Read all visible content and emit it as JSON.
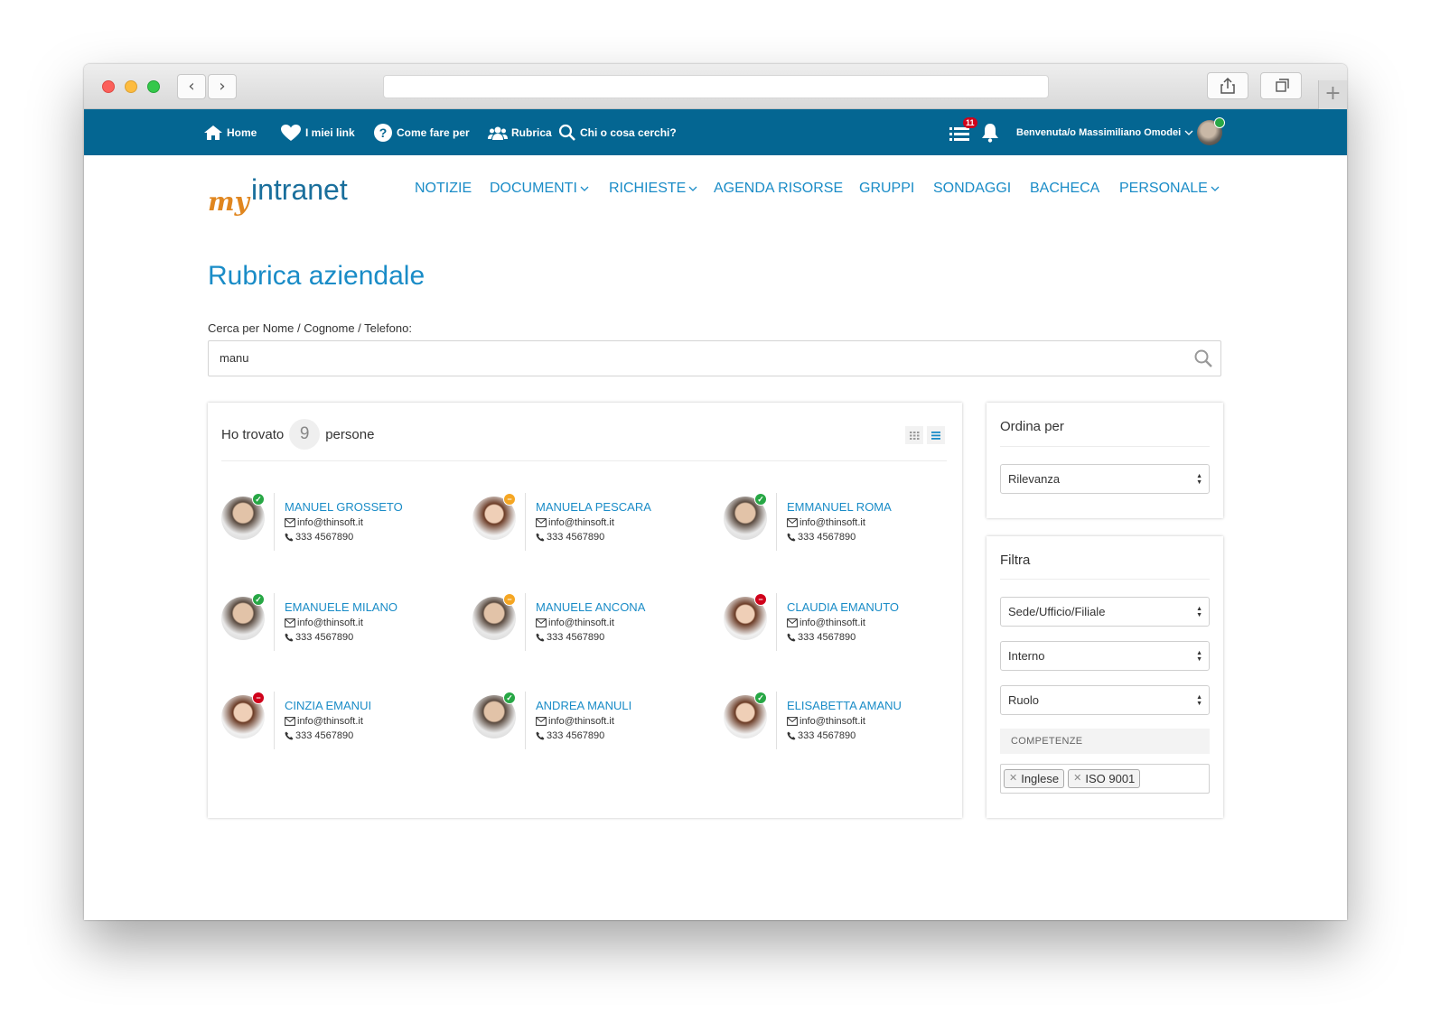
{
  "topbar": {
    "home": "Home",
    "links": "I miei link",
    "howto": "Come fare per",
    "rubrica": "Rubrica",
    "search": "Chi o cosa cerchi?",
    "tasks_count": "11",
    "welcome": "Benvenuta/o Massimiliano Omodei"
  },
  "brand": {
    "my": "my",
    "name": "intranet",
    "accent": "#e0861f",
    "primary": "#1a8cc7",
    "bar": "#046692"
  },
  "nav": {
    "items": [
      "NOTIZIE",
      "DOCUMENTI",
      "RICHIESTE",
      "AGENDA RISORSE",
      "GRUPPI",
      "SONDAGGI",
      "BACHECA",
      "PERSONALE"
    ]
  },
  "page": {
    "title": "Rubrica aziendale",
    "search_label": "Cerca per Nome / Cognome / Telefono:",
    "search_value": "manu"
  },
  "results": {
    "prefix": "Ho trovato",
    "count": "9",
    "suffix": "persone",
    "people": [
      {
        "name": "MANUEL GROSSETO",
        "email": "info@thinsoft.it",
        "phone": "333 4567890",
        "status": "online"
      },
      {
        "name": "MANUELA PESCARA",
        "email": "info@thinsoft.it",
        "phone": "333 4567890",
        "status": "away"
      },
      {
        "name": "EMMANUEL ROMA",
        "email": "info@thinsoft.it",
        "phone": "333 4567890",
        "status": "online"
      },
      {
        "name": "EMANUELE MILANO",
        "email": "info@thinsoft.it",
        "phone": "333 4567890",
        "status": "online"
      },
      {
        "name": "MANUELE ANCONA",
        "email": "info@thinsoft.it",
        "phone": "333 4567890",
        "status": "away"
      },
      {
        "name": "CLAUDIA EMANUTO",
        "email": "info@thinsoft.it",
        "phone": "333 4567890",
        "status": "busy"
      },
      {
        "name": "CINZIA EMANUI",
        "email": "info@thinsoft.it",
        "phone": "333 4567890",
        "status": "busy"
      },
      {
        "name": "ANDREA MANULI",
        "email": "info@thinsoft.it",
        "phone": "333 4567890",
        "status": "online"
      },
      {
        "name": "ELISABETTA AMANU",
        "email": "info@thinsoft.it",
        "phone": "333 4567890",
        "status": "online"
      }
    ]
  },
  "sort": {
    "title": "Ordina per",
    "value": "Rilevanza"
  },
  "filter": {
    "title": "Filtra",
    "office": "Sede/Ufficio/Filiale",
    "internal": "Interno",
    "role": "Ruolo",
    "competences_label": "COMPETENZE",
    "tags": [
      "Inglese",
      "ISO 9001"
    ]
  },
  "status_colors": {
    "online": "#27a745",
    "away": "#f5a623",
    "busy": "#d0021b"
  }
}
